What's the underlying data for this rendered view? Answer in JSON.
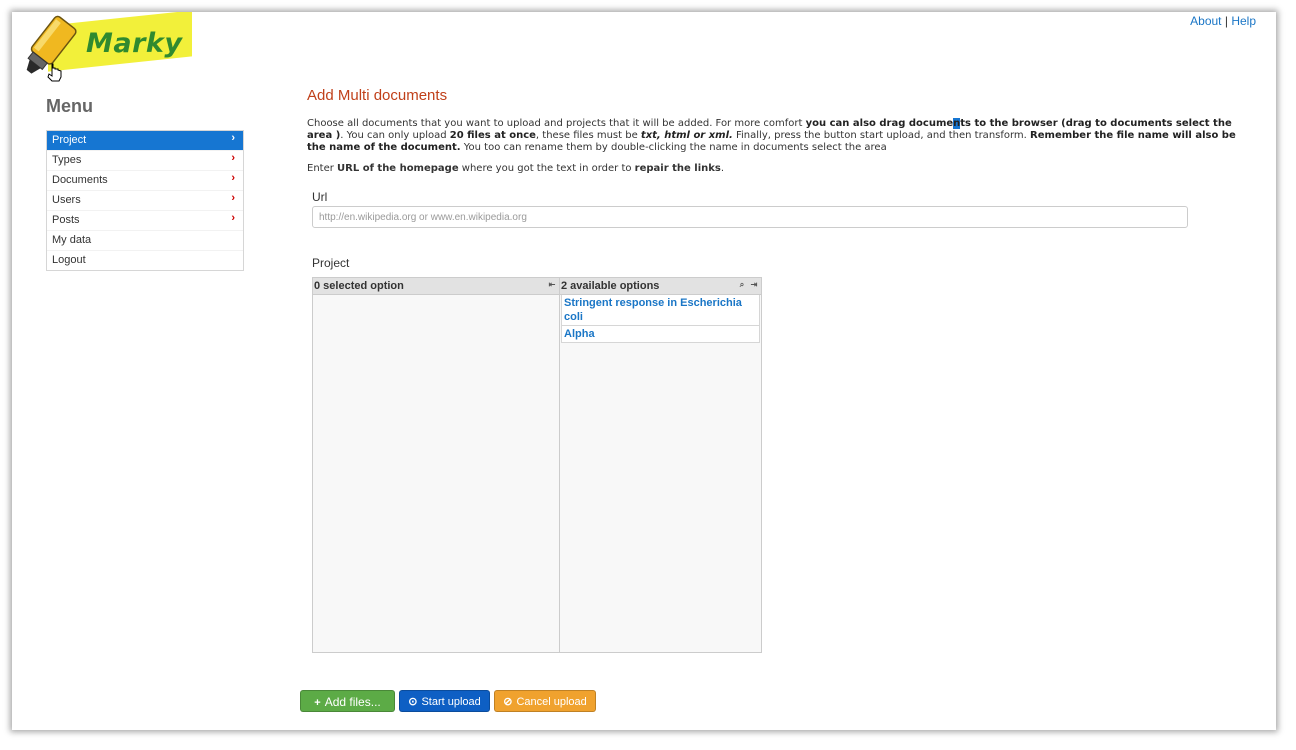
{
  "header": {
    "logo_text": "Marky",
    "about_label": "About",
    "separator": "|",
    "help_label": "Help"
  },
  "sidebar": {
    "title": "Menu",
    "items": [
      {
        "label": "Project",
        "chevron": "›"
      },
      {
        "label": "Types",
        "chevron": "›"
      },
      {
        "label": "Documents",
        "chevron": "›"
      },
      {
        "label": "Users",
        "chevron": "›"
      },
      {
        "label": "Posts",
        "chevron": "›"
      },
      {
        "label": "My data"
      },
      {
        "label": "Logout"
      }
    ]
  },
  "main": {
    "title": "Add Multi documents",
    "desc": {
      "p1": "Choose all documents that you want to upload and projects that it will be added. For more comfort ",
      "b1a": "you can also drag docume",
      "b1hl": "n",
      "b1b": "ts to the browser (drag to documents select the area )",
      "p2": ". You can only upload ",
      "b2": "20 files at once",
      "p3": ", these files must be ",
      "b3": "txt, html or xml.",
      "p4": " Finally, press the button start upload, and then transform. ",
      "b4": "Remember the file name will also be the name of the document.",
      "p5": " You too can rename them by double-clicking the name in documents select the area"
    },
    "desc2": {
      "p1": "Enter ",
      "b1": "URL of the homepage",
      "p2": " where you got the text in order to ",
      "b2": "repair the links",
      "p3": "."
    },
    "url_label": "Url",
    "url_placeholder": "http://en.wikipedia.org or www.en.wikipedia.org",
    "project_label": "Project",
    "selected_header": "0 selected option",
    "available_header": "2 available options",
    "available_options": [
      "Stringent response in Escherichia coli",
      "Alpha"
    ]
  },
  "buttons": {
    "add_files": "Add files...",
    "start_upload": "Start upload",
    "cancel_upload": "Cancel upload"
  },
  "colors": {
    "accent": "#1676d2",
    "title": "#c0401a",
    "add": "#5cab46",
    "start": "#0e5fc4",
    "cancel": "#f0a22e"
  }
}
